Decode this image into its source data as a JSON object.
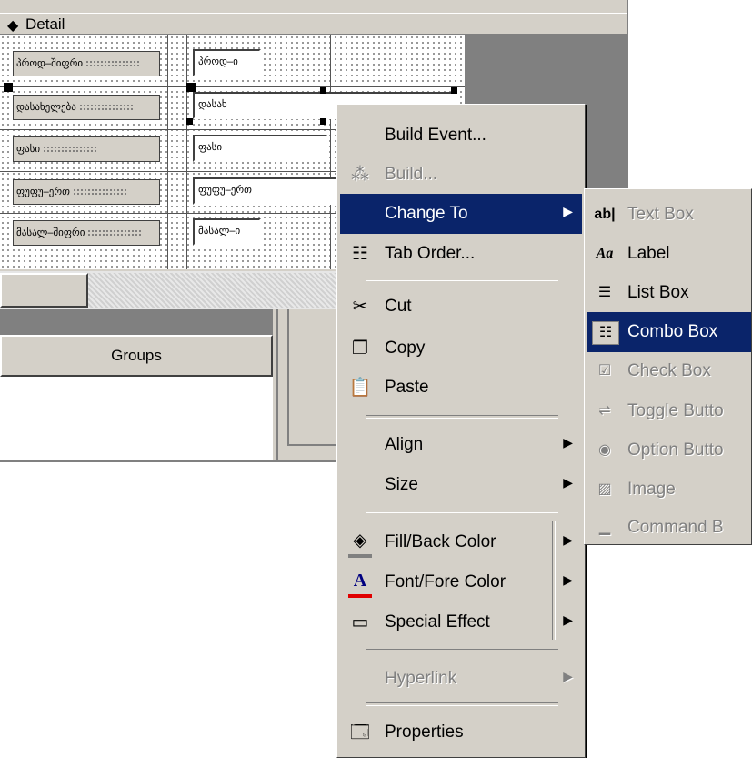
{
  "designer": {
    "section_title": "Detail",
    "fields": [
      {
        "label": "პროდ–შიფრი",
        "value": "პროდ–ი"
      },
      {
        "label": "დასახელება",
        "value": "დასახ"
      },
      {
        "label": "ფასი",
        "value": "ფასი"
      },
      {
        "label": "ფუფუ–ერთ",
        "value": "ფუფუ–ერთ"
      },
      {
        "label": "მასალ–შიფრი",
        "value": "მასალ–ი"
      }
    ],
    "groups_button": "Groups"
  },
  "context_menu": {
    "items": {
      "build_event": {
        "label": "Build Event..."
      },
      "build": {
        "label": "Build..."
      },
      "change_to": {
        "label": "Change To"
      },
      "tab_order": {
        "label": "Tab Order..."
      },
      "cut": {
        "label": "Cut"
      },
      "copy": {
        "label": "Copy"
      },
      "paste": {
        "label": "Paste"
      },
      "align": {
        "label": "Align"
      },
      "size": {
        "label": "Size"
      },
      "fill_back_color": {
        "label": "Fill/Back Color"
      },
      "font_fore_color": {
        "label": "Font/Fore Color"
      },
      "special_effect": {
        "label": "Special Effect"
      },
      "hyperlink": {
        "label": "Hyperlink"
      },
      "properties": {
        "label": "Properties"
      }
    }
  },
  "change_to_submenu": {
    "items": {
      "text_box": {
        "label": "Text Box"
      },
      "label": {
        "label": "Label"
      },
      "list_box": {
        "label": "List Box"
      },
      "combo_box": {
        "label": "Combo Box"
      },
      "check_box": {
        "label": "Check Box"
      },
      "toggle_button": {
        "label": "Toggle Butto"
      },
      "option_button": {
        "label": "Option Butto"
      },
      "image": {
        "label": "Image"
      },
      "command_button": {
        "label": "Command B"
      }
    }
  },
  "colors": {
    "highlight": "#0a246a",
    "face": "#d4d0c8",
    "shadow": "#808080"
  }
}
